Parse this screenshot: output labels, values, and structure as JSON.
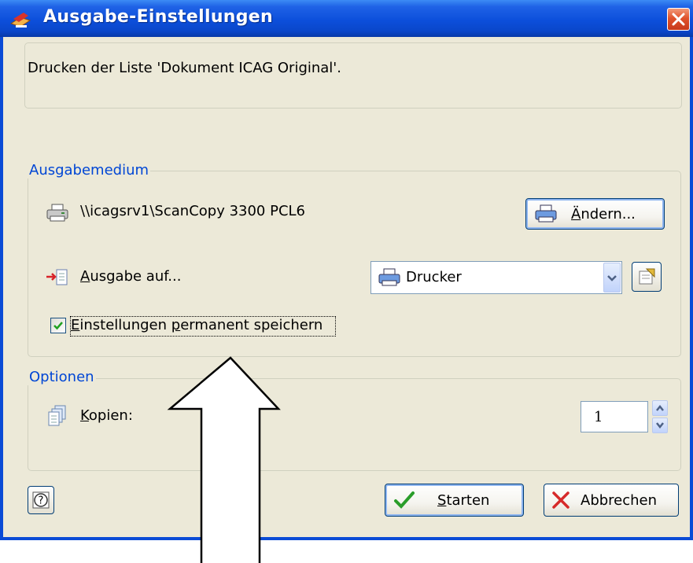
{
  "window": {
    "title": "Ausgabe-Einstellungen",
    "close_symbol": "X"
  },
  "info": {
    "text": "Drucken der Liste 'Dokument ICAG Original'."
  },
  "ausgabemedium": {
    "group_title": "Ausgabemedium",
    "printer_name": "\\\\icagsrv1\\ScanCopy 3300 PCL6",
    "change_button": {
      "label_mnemonic": "Ä",
      "label_rest": "ndern..."
    },
    "output_label": {
      "mnemonic": "A",
      "rest": "usgabe auf..."
    },
    "output_select": {
      "selected": "Drucker"
    },
    "save_checkbox": {
      "checked": true,
      "label_mnemonic": "E",
      "label_middle": "instellungen ",
      "label_mnemonic2": "p",
      "label_rest": "ermanent speichern"
    }
  },
  "optionen": {
    "group_title": "Optionen",
    "copies_label": {
      "mnemonic": "K",
      "rest": "opien:"
    },
    "copies_value": "1"
  },
  "footer": {
    "help_symbol": "?",
    "start_button": {
      "mnemonic": "S",
      "rest": "tarten"
    },
    "cancel_button": {
      "label": "Abbrechen"
    }
  },
  "icons": {
    "title": "app-logo-icon",
    "printer": "printer-icon",
    "output": "output-arrow-icon",
    "copies": "copies-icon",
    "start": "checkmark-icon",
    "cancel": "red-x-icon",
    "properties": "properties-icon",
    "help": "help-icon",
    "annotation": "up-arrow-annotation"
  },
  "colors": {
    "titlebar": "#0c4fdb",
    "dialog_bg": "#ece9d8",
    "group_title": "#0046d5",
    "close_button": "#e0532c"
  }
}
